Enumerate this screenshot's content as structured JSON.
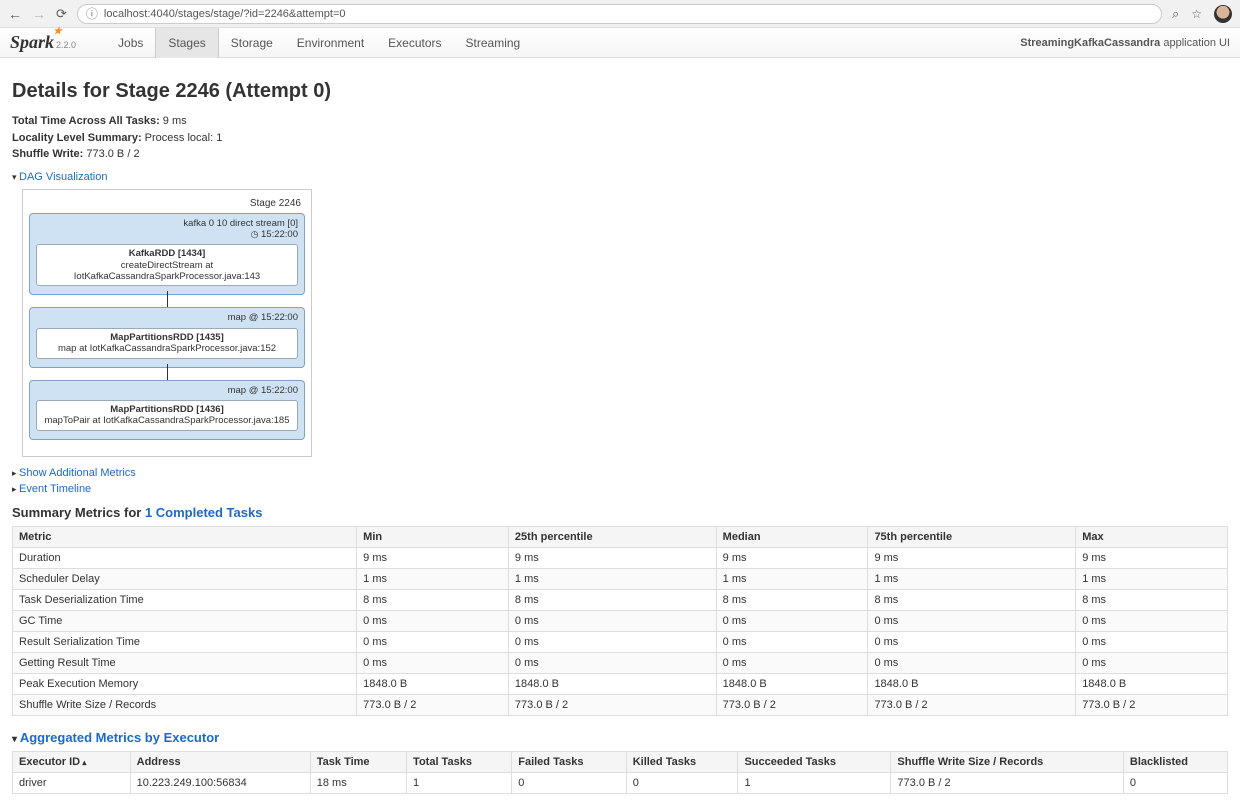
{
  "browser": {
    "url": "localhost:4040/stages/stage/?id=2246&attempt=0"
  },
  "app": {
    "logo_main": "Spark",
    "logo_ver": "2.2.0",
    "tabs": [
      "Jobs",
      "Stages",
      "Storage",
      "Environment",
      "Executors",
      "Streaming"
    ],
    "active_tab": 1,
    "right_bold": "StreamingKafkaCassandra",
    "right_rest": " application UI"
  },
  "page": {
    "title": "Details for Stage 2246 (Attempt 0)",
    "meta": [
      {
        "label": "Total Time Across All Tasks:",
        "value": "9 ms"
      },
      {
        "label": "Locality Level Summary:",
        "value": "Process local: 1"
      },
      {
        "label": "Shuffle Write:",
        "value": "773.0 B / 2"
      }
    ],
    "dag_link": "DAG Visualization",
    "add_metrics_link": "Show Additional Metrics",
    "timeline_link": "Event Timeline"
  },
  "dag": {
    "stage_label": "Stage 2246",
    "blocks": [
      {
        "top": "kafka 0 10 direct stream [0]",
        "time": "15:22:00",
        "node_top": "KafkaRDD [1434]",
        "node_sub": "createDirectStream at IotKafkaCassandraSparkProcessor.java:143"
      },
      {
        "top": "map @ 15:22:00",
        "time": "",
        "node_top": "MapPartitionsRDD [1435]",
        "node_sub": "map at IotKafkaCassandraSparkProcessor.java:152"
      },
      {
        "top": "map @ 15:22:00",
        "time": "",
        "node_top": "MapPartitionsRDD [1436]",
        "node_sub": "mapToPair at IotKafkaCassandraSparkProcessor.java:185"
      }
    ]
  },
  "summary": {
    "heading_pre": "Summary Metrics for ",
    "heading_link": "1 Completed Tasks",
    "columns": [
      "Metric",
      "Min",
      "25th percentile",
      "Median",
      "75th percentile",
      "Max"
    ],
    "rows": [
      [
        "Duration",
        "9 ms",
        "9 ms",
        "9 ms",
        "9 ms",
        "9 ms"
      ],
      [
        "Scheduler Delay",
        "1 ms",
        "1 ms",
        "1 ms",
        "1 ms",
        "1 ms"
      ],
      [
        "Task Deserialization Time",
        "8 ms",
        "8 ms",
        "8 ms",
        "8 ms",
        "8 ms"
      ],
      [
        "GC Time",
        "0 ms",
        "0 ms",
        "0 ms",
        "0 ms",
        "0 ms"
      ],
      [
        "Result Serialization Time",
        "0 ms",
        "0 ms",
        "0 ms",
        "0 ms",
        "0 ms"
      ],
      [
        "Getting Result Time",
        "0 ms",
        "0 ms",
        "0 ms",
        "0 ms",
        "0 ms"
      ],
      [
        "Peak Execution Memory",
        "1848.0 B",
        "1848.0 B",
        "1848.0 B",
        "1848.0 B",
        "1848.0 B"
      ],
      [
        "Shuffle Write Size / Records",
        "773.0 B / 2",
        "773.0 B / 2",
        "773.0 B / 2",
        "773.0 B / 2",
        "773.0 B / 2"
      ]
    ]
  },
  "agg": {
    "heading": "Aggregated Metrics by Executor",
    "columns": [
      "Executor ID",
      "Address",
      "Task Time",
      "Total Tasks",
      "Failed Tasks",
      "Killed Tasks",
      "Succeeded Tasks",
      "Shuffle Write Size / Records",
      "Blacklisted"
    ],
    "rows": [
      [
        "driver",
        "10.223.249.100:56834",
        "18 ms",
        "1",
        "0",
        "0",
        "1",
        "773.0 B / 2",
        "0"
      ]
    ]
  }
}
